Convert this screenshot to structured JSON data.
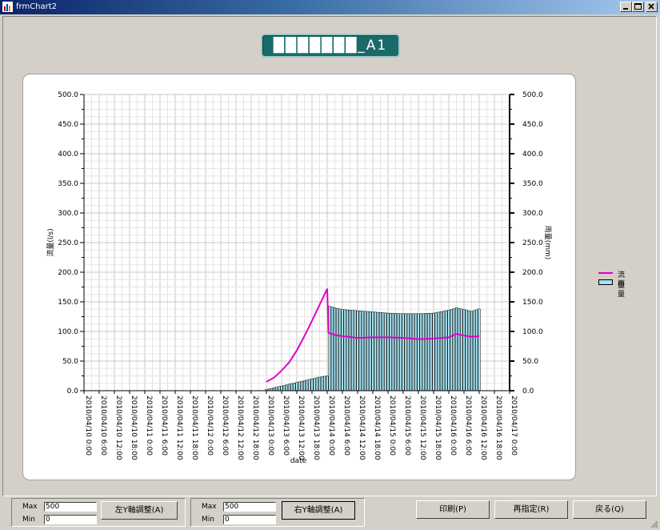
{
  "window": {
    "title": "frmChart2",
    "controls": [
      "minimize",
      "maximize",
      "close"
    ]
  },
  "chart": {
    "title": "███████_A1",
    "left_axis_label": "流量(l/s)",
    "right_axis_label": "雨量(mm)",
    "x_axis_label": "date",
    "left_ticks": [
      "0.0",
      "50.0",
      "100.0",
      "150.0",
      "200.0",
      "250.0",
      "300.0",
      "350.0",
      "400.0",
      "450.0",
      "500.0"
    ],
    "right_ticks": [
      "0.0",
      "50.0",
      "100.0",
      "150.0",
      "200.0",
      "250.0",
      "300.0",
      "350.0",
      "400.0",
      "450.0",
      "500.0"
    ],
    "x_ticks": [
      "2010/04/10 0:00",
      "2010/04/10 6:00",
      "2010/04/10 12:00",
      "2010/04/10 18:00",
      "2010/04/11 0:00",
      "2010/04/11 6:00",
      "2010/04/11 12:00",
      "2010/04/11 18:00",
      "2010/04/12 0:00",
      "2010/04/12 6:00",
      "2010/04/12 12:00",
      "2010/04/12 18:00",
      "2010/04/13 0:00",
      "2010/04/13 6:00",
      "2010/04/13 12:00",
      "2010/04/13 18:00",
      "2010/04/14 0:00",
      "2010/04/14 6:00",
      "2010/04/14 12:00",
      "2010/04/14 18:00",
      "2010/04/15 0:00",
      "2010/04/15 6:00",
      "2010/04/15 12:00",
      "2010/04/15 18:00",
      "2010/04/16 0:00",
      "2010/04/16 6:00",
      "2010/04/16 12:00",
      "2010/04/16 18:00",
      "2010/04/17 0:00"
    ],
    "legend": [
      {
        "label": "流量",
        "color": "#e000c8",
        "kind": "line"
      },
      {
        "label": "雨量",
        "color": "#a6e2f0",
        "kind": "bar"
      }
    ]
  },
  "chart_data": {
    "type": "bar+line",
    "x_label": "date",
    "x_start": "2010/04/10 0:00",
    "x_end": "2010/04/17 0:00",
    "ylim_left": [
      0,
      500
    ],
    "ylim_right": [
      0,
      500
    ],
    "grid": true,
    "legend_position": "right",
    "series": [
      {
        "name": "流量",
        "type": "line",
        "axis": "left",
        "color": "#e000c8",
        "points": [
          [
            "2010/04/13 0:00",
            15
          ],
          [
            "2010/04/13 3:00",
            22
          ],
          [
            "2010/04/13 6:00",
            34
          ],
          [
            "2010/04/13 9:00",
            48
          ],
          [
            "2010/04/13 12:00",
            68
          ],
          [
            "2010/04/13 15:00",
            92
          ],
          [
            "2010/04/13 18:00",
            118
          ],
          [
            "2010/04/13 21:00",
            145
          ],
          [
            "2010/04/14 0:00",
            172
          ],
          [
            "2010/04/14 0:30",
            98
          ],
          [
            "2010/04/14 3:00",
            94
          ],
          [
            "2010/04/14 6:00",
            92
          ],
          [
            "2010/04/14 12:00",
            89
          ],
          [
            "2010/04/14 18:00",
            90
          ],
          [
            "2010/04/15 0:00",
            90
          ],
          [
            "2010/04/15 6:00",
            89
          ],
          [
            "2010/04/15 12:00",
            87
          ],
          [
            "2010/04/15 18:00",
            88
          ],
          [
            "2010/04/16 0:00",
            90
          ],
          [
            "2010/04/16 3:00",
            96
          ],
          [
            "2010/04/16 6:00",
            93
          ],
          [
            "2010/04/16 9:00",
            91
          ],
          [
            "2010/04/16 12:00",
            92
          ]
        ]
      },
      {
        "name": "雨量",
        "type": "bar",
        "axis": "right",
        "color": "#a6e2f0",
        "points": [
          [
            "2010/04/13 0:00",
            2
          ],
          [
            "2010/04/13 3:00",
            5
          ],
          [
            "2010/04/13 6:00",
            8
          ],
          [
            "2010/04/13 9:00",
            11
          ],
          [
            "2010/04/13 12:00",
            14
          ],
          [
            "2010/04/13 15:00",
            17
          ],
          [
            "2010/04/13 18:00",
            20
          ],
          [
            "2010/04/13 21:00",
            23
          ],
          [
            "2010/04/14 0:00",
            25
          ],
          [
            "2010/04/14 0:30",
            143
          ],
          [
            "2010/04/14 3:00",
            140
          ],
          [
            "2010/04/14 6:00",
            137
          ],
          [
            "2010/04/14 12:00",
            135
          ],
          [
            "2010/04/14 18:00",
            133
          ],
          [
            "2010/04/15 0:00",
            131
          ],
          [
            "2010/04/15 6:00",
            130
          ],
          [
            "2010/04/15 12:00",
            130
          ],
          [
            "2010/04/15 18:00",
            131
          ],
          [
            "2010/04/16 0:00",
            136
          ],
          [
            "2010/04/16 3:00",
            140
          ],
          [
            "2010/04/16 6:00",
            137
          ],
          [
            "2010/04/16 9:00",
            134
          ],
          [
            "2010/04/16 12:00",
            138
          ]
        ]
      }
    ]
  },
  "left_adjust": {
    "max_label": "Max",
    "min_label": "Min",
    "max_value": "500",
    "min_value": "0",
    "button": "左Y軸調整(A)"
  },
  "right_adjust": {
    "max_label": "Max",
    "min_label": "Min",
    "max_value": "500",
    "min_value": "0",
    "button": "右Y軸調整(A)"
  },
  "actions": {
    "print": "印刷(P)",
    "respecify": "再指定(R)",
    "back": "戻る(Q)"
  }
}
